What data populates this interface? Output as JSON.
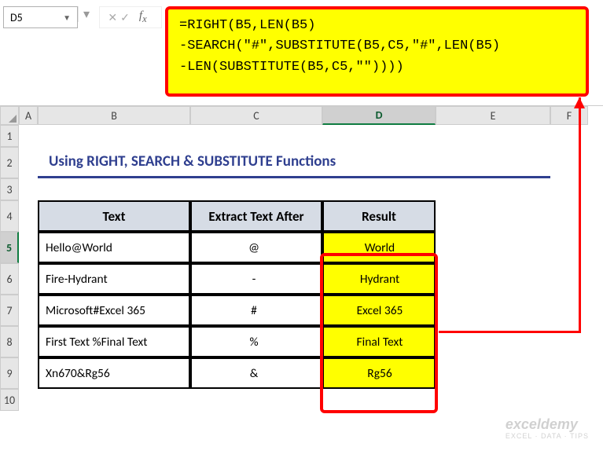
{
  "cellRef": "D5",
  "formula": {
    "line1": "=RIGHT(B5,LEN(B5)",
    "line2": "-SEARCH(\"#\",SUBSTITUTE(B5,C5,\"#\",LEN(B5)",
    "line3": "-LEN(SUBSTITUTE(B5,C5,\"\"))))"
  },
  "columns": [
    "A",
    "B",
    "C",
    "D",
    "E",
    "F"
  ],
  "rows": [
    "1",
    "2",
    "3",
    "4",
    "5",
    "6",
    "7",
    "8",
    "9",
    "10"
  ],
  "title": "Using RIGHT, SEARCH & SUBSTITUTE Functions",
  "headers": {
    "text": "Text",
    "extract": "Extract Text After",
    "result": "Result"
  },
  "data": [
    {
      "text": "Hello@World",
      "delim": "@",
      "result": "World"
    },
    {
      "text": "Fire-Hydrant",
      "delim": "-",
      "result": "Hydrant"
    },
    {
      "text": "Microsoft#Excel 365",
      "delim": "#",
      "result": "Excel 365"
    },
    {
      "text": "First Text %Final Text",
      "delim": "%",
      "result": "Final Text"
    },
    {
      "text": "Xn670&Rg56",
      "delim": "&",
      "result": "Rg56"
    }
  ],
  "watermark": {
    "line1": "exceldemy",
    "line2": "EXCEL · DATA · TIPS"
  }
}
